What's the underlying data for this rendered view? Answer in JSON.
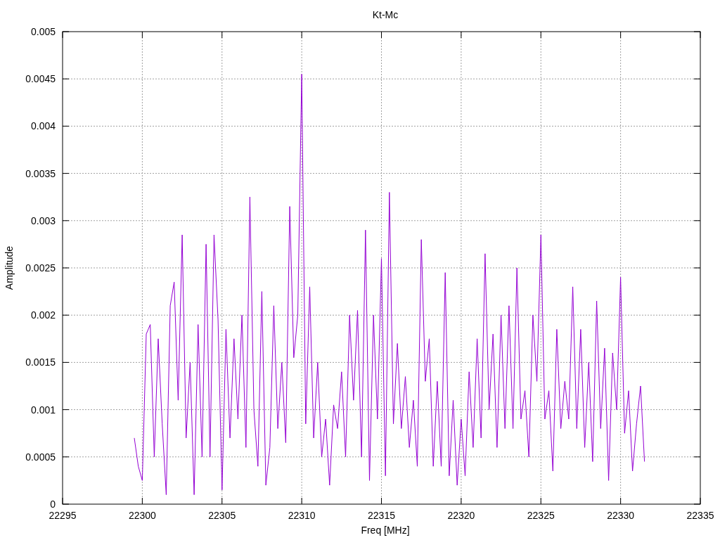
{
  "chart_data": {
    "type": "line",
    "grid": true,
    "title": "Kt-Mc",
    "xlabel": "Freq [MHz]",
    "ylabel": "Amplitude",
    "xlim": [
      22295,
      22335
    ],
    "ylim": [
      0,
      0.005
    ],
    "xticks": [
      22295,
      22300,
      22305,
      22310,
      22315,
      22320,
      22325,
      22330,
      22335
    ],
    "yticks": [
      {
        "value": 0,
        "label": "0"
      },
      {
        "value": 0.0005,
        "label": "0.0005"
      },
      {
        "value": 0.001,
        "label": "0.001"
      },
      {
        "value": 0.0015,
        "label": "0.0015"
      },
      {
        "value": 0.002,
        "label": "0.002"
      },
      {
        "value": 0.0025,
        "label": "0.0025"
      },
      {
        "value": 0.003,
        "label": "0.003"
      },
      {
        "value": 0.0035,
        "label": "0.0035"
      },
      {
        "value": 0.004,
        "label": "0.004"
      },
      {
        "value": 0.0045,
        "label": "0.0045"
      },
      {
        "value": 0.005,
        "label": "0.005"
      }
    ],
    "x": [
      22299.5,
      22299.75,
      22300,
      22300.25,
      22300.5,
      22300.75,
      22301,
      22301.25,
      22301.5,
      22301.75,
      22302,
      22302.25,
      22302.5,
      22302.75,
      22303,
      22303.25,
      22303.5,
      22303.75,
      22304,
      22304.25,
      22304.5,
      22304.75,
      22305,
      22305.25,
      22305.5,
      22305.75,
      22306,
      22306.25,
      22306.5,
      22306.75,
      22307,
      22307.25,
      22307.5,
      22307.75,
      22308,
      22308.25,
      22308.5,
      22308.75,
      22309,
      22309.25,
      22309.5,
      22309.75,
      22310,
      22310.25,
      22310.5,
      22310.75,
      22311,
      22311.25,
      22311.5,
      22311.75,
      22312,
      22312.25,
      22312.5,
      22312.75,
      22313,
      22313.25,
      22313.5,
      22313.75,
      22314,
      22314.25,
      22314.5,
      22314.75,
      22315,
      22315.25,
      22315.5,
      22315.75,
      22316,
      22316.25,
      22316.5,
      22316.75,
      22317,
      22317.25,
      22317.5,
      22317.75,
      22318,
      22318.25,
      22318.5,
      22318.75,
      22319,
      22319.25,
      22319.5,
      22319.75,
      22320,
      22320.25,
      22320.5,
      22320.75,
      22321,
      22321.25,
      22321.5,
      22321.75,
      22322,
      22322.25,
      22322.5,
      22322.75,
      22323,
      22323.25,
      22323.5,
      22323.75,
      22324,
      22324.25,
      22324.5,
      22324.75,
      22325,
      22325.25,
      22325.5,
      22325.75,
      22326,
      22326.25,
      22326.5,
      22326.75,
      22327,
      22327.25,
      22327.5,
      22327.75,
      22328,
      22328.25,
      22328.5,
      22328.75,
      22329,
      22329.25,
      22329.5,
      22329.75,
      22330,
      22330.25,
      22330.5,
      22330.75,
      22331,
      22331.25,
      22331.5
    ],
    "series": [
      {
        "color": "#9400d3",
        "values": [
          0.0007,
          0.0004,
          0.00025,
          0.0018,
          0.0019,
          0.0005,
          0.00175,
          0.00085,
          0.0001,
          0.0021,
          0.00235,
          0.0011,
          0.00285,
          0.0007,
          0.0015,
          0.0001,
          0.0019,
          0.0005,
          0.00275,
          0.0005,
          0.00285,
          0.00195,
          0.00015,
          0.00185,
          0.0007,
          0.00175,
          0.0009,
          0.002,
          0.0006,
          0.00325,
          0.001,
          0.0004,
          0.00225,
          0.0002,
          0.0006,
          0.0021,
          0.0008,
          0.0015,
          0.00065,
          0.00315,
          0.00155,
          0.002,
          0.00455,
          0.00085,
          0.0023,
          0.0007,
          0.0015,
          0.0005,
          0.0009,
          0.0002,
          0.00105,
          0.0008,
          0.0014,
          0.0005,
          0.002,
          0.0011,
          0.00205,
          0.0005,
          0.0029,
          0.00025,
          0.002,
          0.0009,
          0.0026,
          0.0003,
          0.0033,
          0.00085,
          0.0017,
          0.0008,
          0.00135,
          0.0006,
          0.0011,
          0.0004,
          0.0028,
          0.0013,
          0.00175,
          0.0004,
          0.0013,
          0.0004,
          0.00245,
          0.0003,
          0.0011,
          0.0002,
          0.0009,
          0.0003,
          0.0014,
          0.0006,
          0.00175,
          0.0007,
          0.00265,
          0.001,
          0.0018,
          0.0006,
          0.002,
          0.0008,
          0.0021,
          0.0008,
          0.0025,
          0.0009,
          0.0012,
          0.0005,
          0.002,
          0.0013,
          0.00285,
          0.0009,
          0.0012,
          0.00035,
          0.00185,
          0.0008,
          0.0013,
          0.0009,
          0.0023,
          0.0008,
          0.00185,
          0.0006,
          0.0015,
          0.00045,
          0.00215,
          0.0008,
          0.00165,
          0.00025,
          0.0016,
          0.001,
          0.0024,
          0.00075,
          0.0012,
          0.00035,
          0.00085,
          0.00125,
          0.00045
        ]
      }
    ]
  }
}
